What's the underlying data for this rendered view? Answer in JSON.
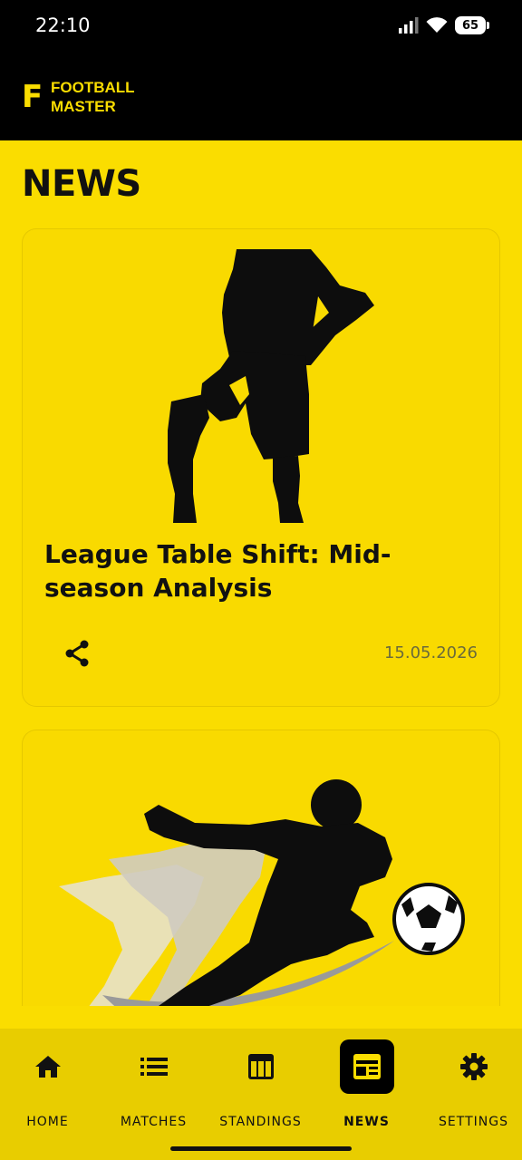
{
  "status_bar": {
    "time": "22:10",
    "battery": "65"
  },
  "header": {
    "logo_letter": "F",
    "logo_line1": "FOOTBALL",
    "logo_line2": "MASTER"
  },
  "page": {
    "title": "NEWS"
  },
  "news": [
    {
      "title": "League Table Shift: Mid-season Analysis",
      "date": "15.05.2026"
    },
    {
      "title": "",
      "date": ""
    }
  ],
  "nav": {
    "items": [
      {
        "label": "HOME"
      },
      {
        "label": "MATCHES"
      },
      {
        "label": "STANDINGS"
      },
      {
        "label": "NEWS"
      },
      {
        "label": "SETTINGS"
      }
    ],
    "active": "NEWS"
  },
  "colors": {
    "accent": "#FADD00",
    "header_bg": "#000000",
    "nav_bg": "#E8CD00"
  }
}
